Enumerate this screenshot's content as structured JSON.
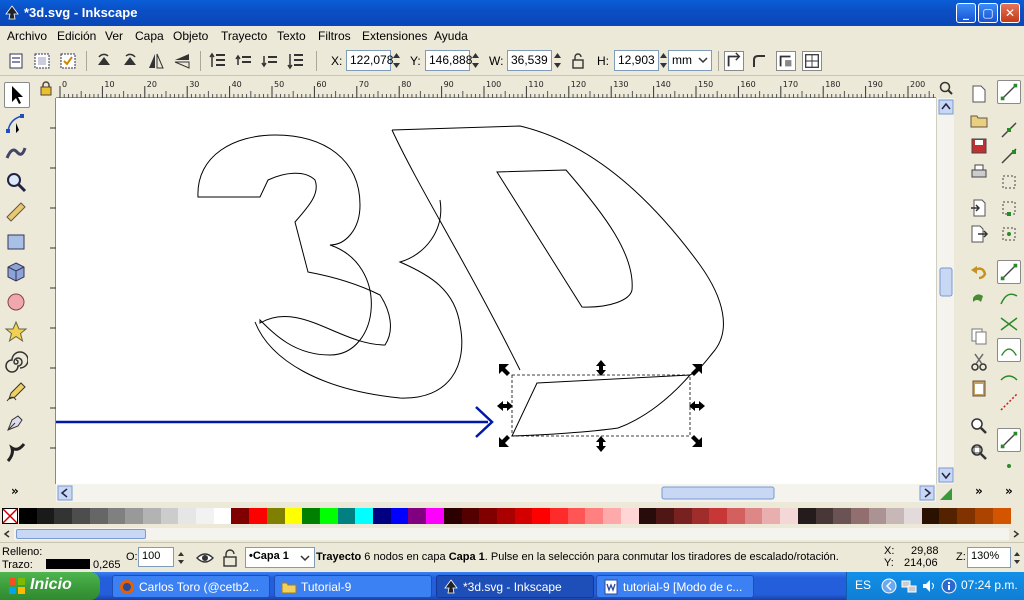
{
  "window": {
    "title": "*3d.svg - Inkscape",
    "minimize": "_",
    "maximize": "▢",
    "close": "✕"
  },
  "menu": [
    "Archivo",
    "Edición",
    "Ver",
    "Capa",
    "Objeto",
    "Trayecto",
    "Texto",
    "Filtros",
    "Extensiones",
    "Ayuda"
  ],
  "controls": {
    "x_label": "X:",
    "x_value": "122,078",
    "y_label": "Y:",
    "y_value": "146,888",
    "w_label": "W:",
    "w_value": "36,539",
    "h_label": "H:",
    "h_value": "12,903",
    "unit": "mm"
  },
  "ruler": {
    "labels": [
      "0",
      "10",
      "20",
      "30",
      "40",
      "50",
      "60",
      "70",
      "80",
      "90",
      "100",
      "110",
      "120",
      "130",
      "140",
      "150",
      "160",
      "170",
      "180",
      "190",
      "200"
    ]
  },
  "overflow": "»",
  "palette": {
    "colors": [
      "#000000",
      "#1a1a1a",
      "#333333",
      "#4d4d4d",
      "#666666",
      "#808080",
      "#999999",
      "#b3b3b3",
      "#cccccc",
      "#e6e6e6",
      "#f2f2f2",
      "#ffffff",
      "#800000",
      "#ff0000",
      "#808000",
      "#ffff00",
      "#008000",
      "#00ff00",
      "#008080",
      "#00ffff",
      "#000080",
      "#0000ff",
      "#800080",
      "#ff00ff",
      "#2b0000",
      "#550000",
      "#800000",
      "#aa0000",
      "#d40000",
      "#ff0000",
      "#ff2a2a",
      "#ff5555",
      "#ff8080",
      "#ffaaaa",
      "#ffd5d5",
      "#280b0b",
      "#501616",
      "#782121",
      "#a02c2c",
      "#c83737",
      "#d35f5f",
      "#de8787",
      "#e9afaf",
      "#f4d7d7",
      "#241c1c",
      "#483737",
      "#6c5353",
      "#916f6f",
      "#ac9393",
      "#c8b7b7",
      "#e3dbdb",
      "#2b1100",
      "#552200",
      "#803300",
      "#aa4400",
      "#d45500"
    ]
  },
  "status": {
    "fill_label": "Relleno:",
    "stroke_label": "Trazo:",
    "stroke_width": "0,265",
    "opacity_label": "O:",
    "opacity_value": "100",
    "layer": "•Capa 1",
    "message_bold1": "Trayecto",
    "message_part1": " 6 nodos en capa ",
    "message_bold2": "Capa 1",
    "message_part2": ". Pulse en la selección para conmutar los tiradores de escalado/rotación.",
    "x_label": "X:",
    "x_coord": "29,88",
    "y_label": "Y:",
    "y_coord": "214,06",
    "zoom_label": "Z:",
    "zoom_value": "130%"
  },
  "taskbar": {
    "start": "Inicio",
    "tasks": [
      "Carlos Toro (@cetb2...",
      "Tutorial-9",
      "*3d.svg - Inkscape",
      "tutorial-9 [Modo de c..."
    ],
    "lang": "ES",
    "time": "07:24 p.m."
  },
  "colors": {
    "accent": "#0a46b8",
    "arrow": "#0018a8"
  }
}
